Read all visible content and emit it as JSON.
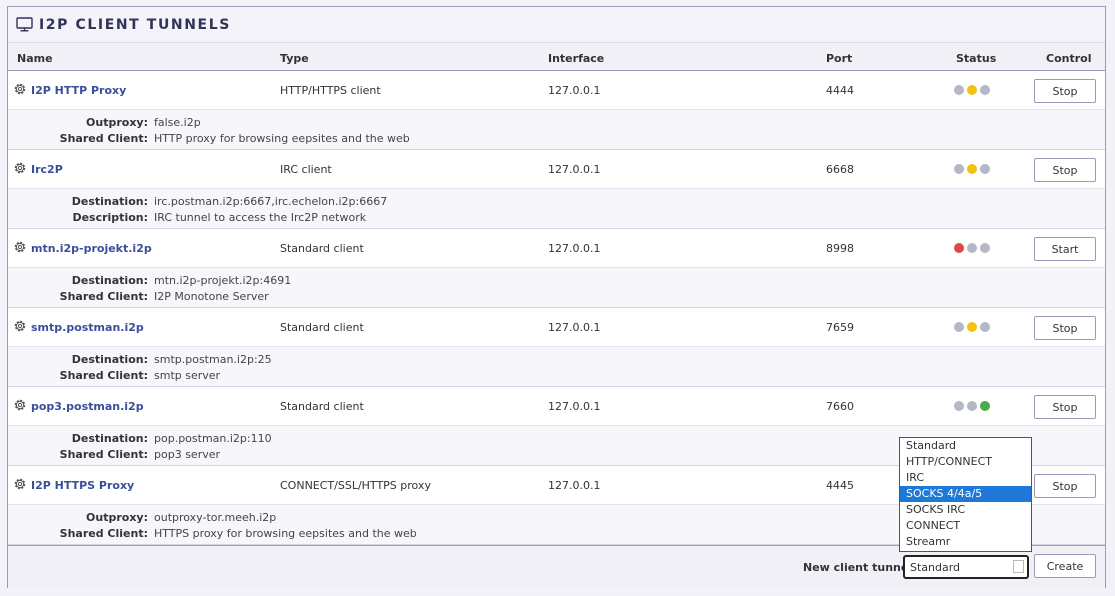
{
  "panel": {
    "title": "I2P CLIENT TUNNELS",
    "title_icon": "monitor-icon"
  },
  "columns": {
    "name": "Name",
    "type": "Type",
    "interface": "Interface",
    "port": "Port",
    "status": "Status",
    "control": "Control"
  },
  "tunnels": [
    {
      "name": "I2P HTTP Proxy",
      "type": "HTTP/HTTPS client",
      "interface": "127.0.0.1",
      "port": "4444",
      "status": [
        "gray",
        "yellow",
        "gray"
      ],
      "control": "Stop",
      "details": [
        {
          "label": "Outproxy:",
          "value": "false.i2p"
        },
        {
          "label": "Shared Client:",
          "value": "HTTP proxy for browsing eepsites and the web"
        }
      ]
    },
    {
      "name": "Irc2P",
      "type": "IRC client",
      "interface": "127.0.0.1",
      "port": "6668",
      "status": [
        "gray",
        "yellow",
        "gray"
      ],
      "control": "Stop",
      "details": [
        {
          "label": "Destination:",
          "value": "irc.postman.i2p:6667,irc.echelon.i2p:6667"
        },
        {
          "label": "Description:",
          "value": "IRC tunnel to access the Irc2P network"
        }
      ]
    },
    {
      "name": "mtn.i2p-projekt.i2p",
      "type": "Standard client",
      "interface": "127.0.0.1",
      "port": "8998",
      "status": [
        "red",
        "gray",
        "gray"
      ],
      "control": "Start",
      "details": [
        {
          "label": "Destination:",
          "value": "mtn.i2p-projekt.i2p:4691"
        },
        {
          "label": "Shared Client:",
          "value": "I2P Monotone Server"
        }
      ]
    },
    {
      "name": "smtp.postman.i2p",
      "type": "Standard client",
      "interface": "127.0.0.1",
      "port": "7659",
      "status": [
        "gray",
        "yellow",
        "gray"
      ],
      "control": "Stop",
      "details": [
        {
          "label": "Destination:",
          "value": "smtp.postman.i2p:25"
        },
        {
          "label": "Shared Client:",
          "value": "smtp server"
        }
      ]
    },
    {
      "name": "pop3.postman.i2p",
      "type": "Standard client",
      "interface": "127.0.0.1",
      "port": "7660",
      "status": [
        "gray",
        "gray",
        "green"
      ],
      "control": "Stop",
      "details": [
        {
          "label": "Destination:",
          "value": "pop.postman.i2p:110"
        },
        {
          "label": "Shared Client:",
          "value": "pop3 server"
        }
      ]
    },
    {
      "name": "I2P HTTPS Proxy",
      "type": "CONNECT/SSL/HTTPS proxy",
      "interface": "127.0.0.1",
      "port": "4445",
      "status": [
        "gray",
        "yellow",
        "gray"
      ],
      "control": "Stop",
      "details": [
        {
          "label": "Outproxy:",
          "value": "outproxy-tor.meeh.i2p"
        },
        {
          "label": "Shared Client:",
          "value": "HTTPS proxy for browsing eepsites and the web"
        }
      ]
    }
  ],
  "footer": {
    "new_label": "New client tunnel:",
    "selected": "Standard",
    "create_label": "Create",
    "options": [
      "Standard",
      "HTTP/CONNECT",
      "IRC",
      "SOCKS 4/4a/5",
      "SOCKS IRC",
      "CONNECT",
      "Streamr"
    ],
    "highlighted_option": "SOCKS 4/4a/5"
  },
  "colors": {
    "link": "#3a4f9a",
    "highlight": "#1e78d7",
    "status_yellow": "#f2c20f",
    "status_red": "#e04848",
    "status_green": "#4caa4c",
    "status_gray": "#b4b8c4"
  }
}
